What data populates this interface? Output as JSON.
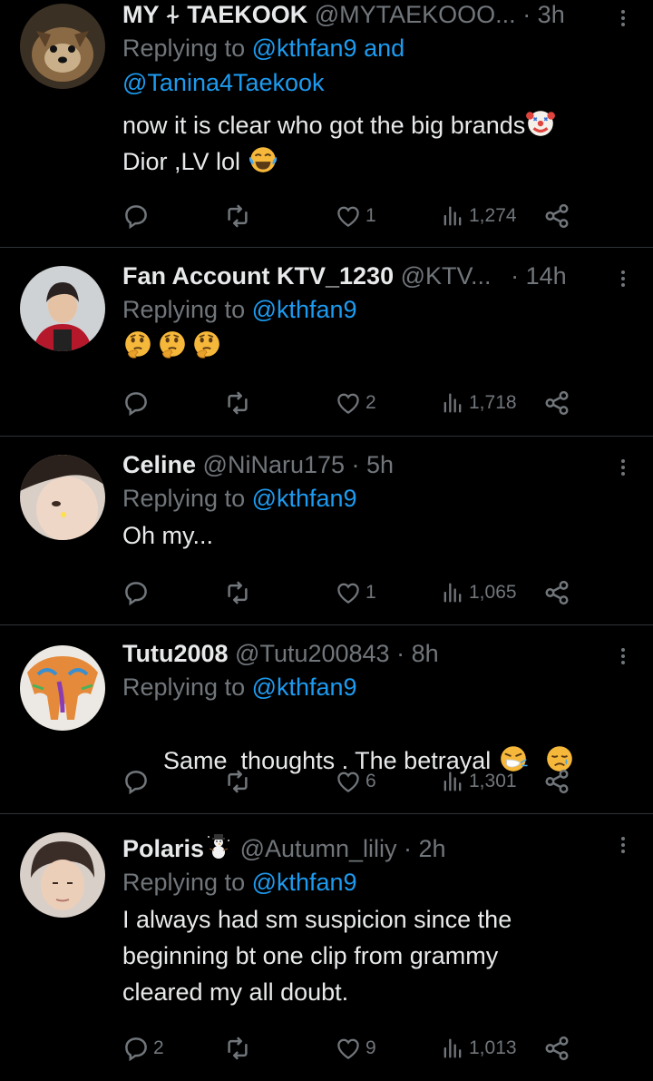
{
  "colors": {
    "background": "#000000",
    "text": "#e7e9ea",
    "muted": "#71767b",
    "link": "#1d9bf0",
    "divider": "#2f3336"
  },
  "tweets": [
    {
      "name": "MY ⍭ TAEKOOK",
      "handle": "@MYTAEKOOO...",
      "time": "· 3h",
      "replying_prefix": "Replying to ",
      "replying_to": "@kthfan9 and @Tanina4Taekook",
      "replying_line1": "@kthfan9 and",
      "replying_line2": "@Tanina4Taekook",
      "text_line1": "now it is clear who got the big brands",
      "text_line2": "Dior ,LV lol ",
      "emojis": [
        "clown-face",
        "face-with-tears-of-joy"
      ],
      "stats": {
        "replies": "",
        "retweets": "",
        "likes": "1",
        "views": "1,274"
      }
    },
    {
      "name": "Fan Account KTV_1230",
      "handle": "@KTV...",
      "time": "· 14h",
      "replying_prefix": "Replying to ",
      "replying_to": "@kthfan9",
      "emojis": [
        "thinking-face",
        "thinking-face",
        "thinking-face"
      ],
      "stats": {
        "replies": "",
        "retweets": "",
        "likes": "2",
        "views": "1,718"
      }
    },
    {
      "name": "Celine",
      "handle": "@NiNaru175",
      "time": "· 5h",
      "replying_prefix": "Replying to ",
      "replying_to": "@kthfan9",
      "text_line1": "Oh my...",
      "stats": {
        "replies": "",
        "retweets": "",
        "likes": "1",
        "views": "1,065"
      }
    },
    {
      "name": "Tutu2008",
      "handle": "@Tutu200843",
      "time": "· 8h",
      "replying_prefix": "Replying to ",
      "replying_to": "@kthfan9",
      "text_line1": "Same  thoughts . The betrayal ",
      "emojis": [
        "sneezing-face",
        "sad-relieved-face"
      ],
      "stats": {
        "replies": "",
        "retweets": "",
        "likes": "6",
        "views": "1,301"
      }
    },
    {
      "name": "Polaris",
      "name_emoji": "snowman",
      "handle": "@Autumn_liliy",
      "time": "· 2h",
      "replying_prefix": "Replying to ",
      "replying_to": "@kthfan9",
      "text_line1": "I always had sm suspicion since the",
      "text_line2": "beginning bt one clip from grammy",
      "text_line3": "cleared my all doubt.",
      "stats": {
        "replies": "2",
        "retweets": "",
        "likes": "9",
        "views": "1,013"
      }
    }
  ]
}
